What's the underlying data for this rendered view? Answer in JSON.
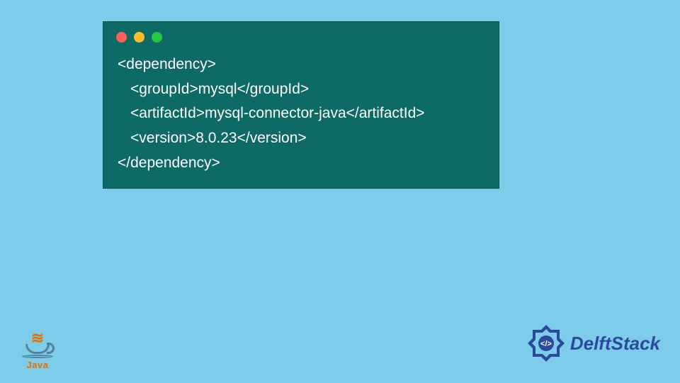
{
  "code": {
    "lines": [
      {
        "indent": 1,
        "text": "<dependency>"
      },
      {
        "indent": 2,
        "text": "<groupId>mysql</groupId>"
      },
      {
        "indent": 2,
        "text": "<artifactId>mysql-connector-java</artifactId>"
      },
      {
        "indent": 2,
        "text": "<version>8.0.23</version>"
      },
      {
        "indent": 1,
        "text": "</dependency>"
      }
    ]
  },
  "logos": {
    "java_label": "Java",
    "delft_label": "DelftStack",
    "delft_badge_text": "</>"
  }
}
